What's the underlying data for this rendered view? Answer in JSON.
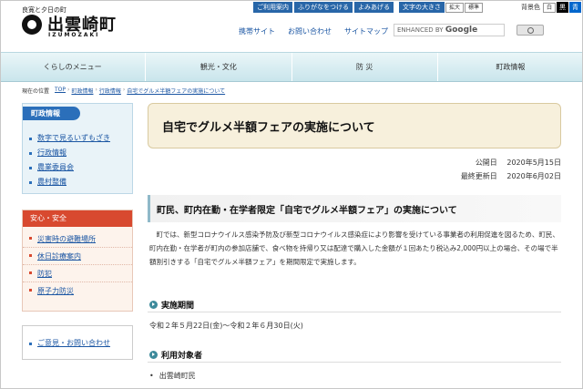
{
  "utility": {
    "buttons": [
      "ご利用案内",
      "ふりがなをつける",
      "よみあげる"
    ],
    "fontsize_label": "文字の大きさ",
    "fontsize_buttons": [
      "拡大",
      "標準"
    ],
    "color_label": "背景色",
    "color_buttons": [
      "白",
      "黒",
      "青"
    ]
  },
  "logo": {
    "tagline": "良寛と夕日の町",
    "name": "出雲崎町",
    "roman": "IZUMOZAKI"
  },
  "header_links": [
    "携帯サイト",
    "お問い合わせ",
    "サイトマップ"
  ],
  "search": {
    "enhanced_by": "ENHANCED BY",
    "brand": "Google"
  },
  "nav": [
    "くらしのメニュー",
    "観光・文化",
    "防 災",
    "町政情報"
  ],
  "breadcrumb": {
    "label": "現在の位置",
    "items": [
      "TOP",
      "町政情報",
      "行政情報",
      "自宅でグルメ半額フェアの実施について"
    ]
  },
  "sidebar": {
    "box1": {
      "title": "町政情報",
      "items": [
        "数字で見るいずもざき",
        "行政情報",
        "農業委員会",
        "農村整備"
      ]
    },
    "box2": {
      "title": "安心・安全",
      "items": [
        "災害時の避難場所",
        "休日診療案内",
        "防犯",
        "原子力防災"
      ]
    },
    "box3": {
      "items": [
        "ご意見・お問い合わせ"
      ]
    }
  },
  "article": {
    "title": "自宅でグルメ半額フェアの実施について",
    "published_label": "公開日",
    "published_date": "2020年5月15日",
    "updated_label": "最終更新日",
    "updated_date": "2020年6月02日",
    "heading": "町民、町内在勤・在学者限定「自宅でグルメ半額フェア」の実施について",
    "paragraph": "町では、新型コロナウイルス感染予防及び新型コロナウイルス感染症により影響を受けている事業者の利用促進を図るため、町民、町内在勤・在学者が町内の参加店舗で、食べ物を持帰り又は配達で購入した金額が１回あたり税込み2,000円以上の場合、その場で半額割引きする「自宅でグルメ半額フェア」を期間限定で実施します。",
    "period_heading": "実施期間",
    "period_text": "令和２年５月22日(金)～令和２年６月30日(火)",
    "target_heading": "利用対象者",
    "target_items": [
      "出雲崎町民"
    ]
  }
}
